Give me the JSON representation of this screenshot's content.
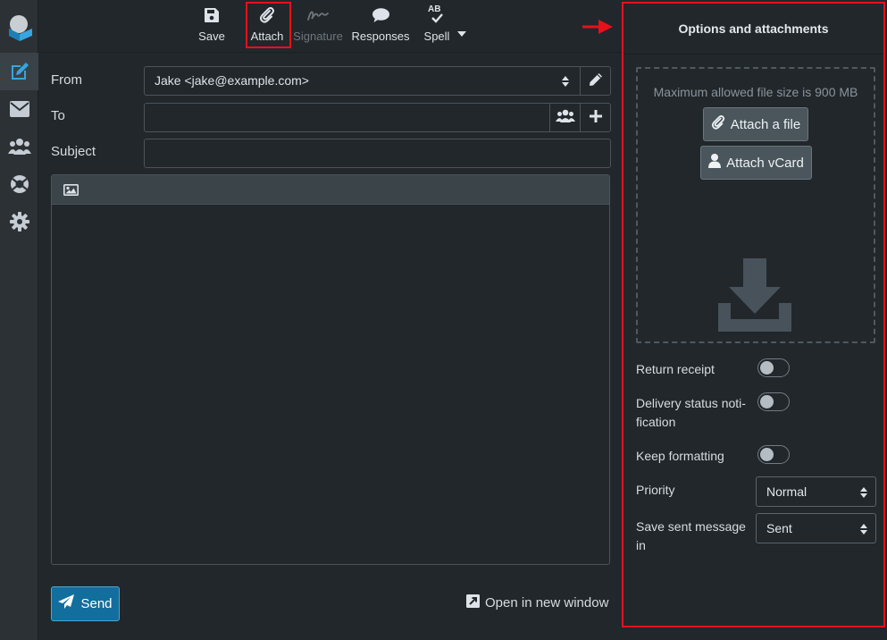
{
  "toolbar": {
    "save": "Save",
    "attach": "Attach",
    "signature": "Signature",
    "responses": "Responses",
    "spell": "Spell",
    "spell_badge": "AB"
  },
  "compose": {
    "from_label": "From",
    "from_value": "Jake <jake@example.com>",
    "to_label": "To",
    "to_value": "",
    "subject_label": "Subject",
    "subject_value": "",
    "send_label": "Send",
    "open_new_window": "Open in new window"
  },
  "panel": {
    "title": "Options and attachments",
    "max_size": "Maximum allowed file size is 900 MB",
    "attach_file": "Attach a file",
    "attach_vcard": "Attach vCard",
    "return_receipt": "Return receipt",
    "return_receipt_on": false,
    "dsn_line1": "Delivery status noti-",
    "dsn_line2": "fication",
    "dsn_on": false,
    "keep_formatting": "Keep formatting",
    "keep_formatting_on": false,
    "priority_label": "Priority",
    "priority_value": "Normal",
    "save_sent_line1": "Save sent message",
    "save_sent_line2": "in",
    "save_sent_value": "Sent"
  },
  "colors": {
    "highlight": "#e8101a",
    "accent": "#2b9fe0",
    "send": "#126e9d"
  },
  "icons": [
    "app-logo-icon",
    "compose-icon",
    "mail-icon",
    "contacts-icon",
    "help-icon",
    "settings-icon",
    "save-icon",
    "paperclip-icon",
    "signature-icon",
    "comment-icon",
    "spellcheck-icon",
    "chevron-down-icon",
    "sort-arrows-icon",
    "pencil-icon",
    "address-book-icon",
    "plus-icon",
    "image-icon",
    "paper-plane-icon",
    "external-window-icon",
    "download-icon",
    "user-icon"
  ]
}
